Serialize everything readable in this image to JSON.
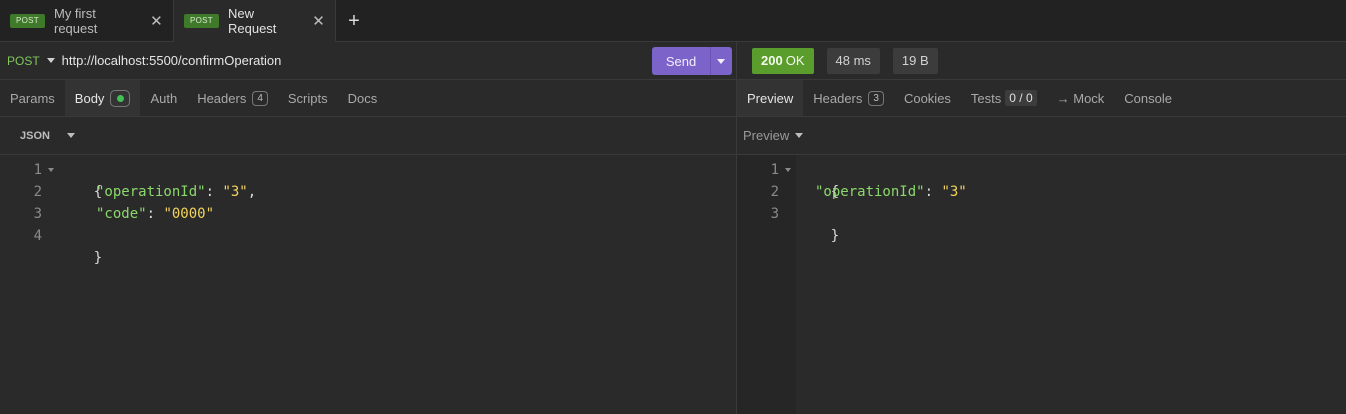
{
  "tabs": [
    {
      "method": "POST",
      "title": "My first request",
      "close": "✕"
    },
    {
      "method": "POST",
      "title": "New Request",
      "close": "✕"
    }
  ],
  "add_tab": "+",
  "request": {
    "method": "POST",
    "url": "http://localhost:5500/confirmOperation",
    "send_label": "Send"
  },
  "response_status": {
    "code": "200",
    "text": "OK",
    "time": "48 ms",
    "size": "19 B",
    "status_color": "#5a9d2c"
  },
  "request_tabs": [
    {
      "label": "Params"
    },
    {
      "label": "Body",
      "active": true
    },
    {
      "label": "Auth"
    },
    {
      "label": "Headers",
      "count": "4"
    },
    {
      "label": "Scripts"
    },
    {
      "label": "Docs"
    }
  ],
  "response_tabs": [
    {
      "label": "Preview",
      "active": true
    },
    {
      "label": "Headers",
      "count": "3"
    },
    {
      "label": "Cookies"
    },
    {
      "label": "Tests",
      "count": "0 / 0"
    },
    {
      "label": "→ Mock"
    },
    {
      "label": "Console"
    }
  ],
  "body_format": "JSON",
  "preview_mode": "Preview",
  "request_body": {
    "line_numbers": [
      "1",
      "2",
      "3",
      "4"
    ],
    "open_brace": "{",
    "close_brace": "}",
    "fields": [
      {
        "key": "\"operationId\"",
        "sep": ": ",
        "value": "\"3\"",
        "trail": ","
      },
      {
        "key": "\"code\"",
        "sep": ": ",
        "value": "\"0000\"",
        "trail": ""
      }
    ]
  },
  "response_body": {
    "line_numbers": [
      "1",
      "2",
      "3"
    ],
    "open_brace": "{",
    "close_brace": "}",
    "fields": [
      {
        "key": "\"operationId\"",
        "sep": ": ",
        "value": "\"3\""
      }
    ]
  }
}
